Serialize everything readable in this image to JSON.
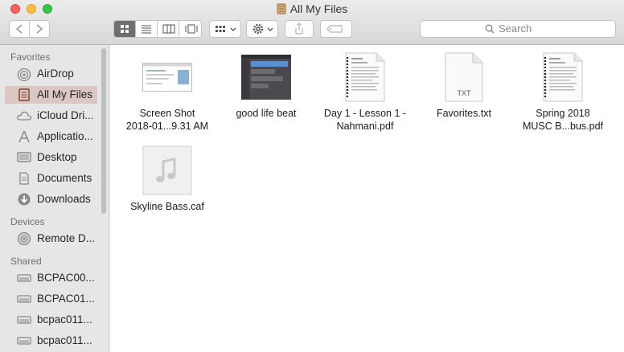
{
  "window": {
    "title": "All My Files"
  },
  "toolbar": {
    "search_placeholder": "Search"
  },
  "sidebar": {
    "sections": [
      {
        "header": "Favorites",
        "items": [
          {
            "label": "AirDrop",
            "icon": "airdrop-icon"
          },
          {
            "label": "All My Files",
            "icon": "all-my-files-icon",
            "selected": true
          },
          {
            "label": "iCloud Dri...",
            "icon": "cloud-icon"
          },
          {
            "label": "Applicatio...",
            "icon": "applications-icon"
          },
          {
            "label": "Desktop",
            "icon": "desktop-icon"
          },
          {
            "label": "Documents",
            "icon": "documents-icon"
          },
          {
            "label": "Downloads",
            "icon": "downloads-icon"
          }
        ]
      },
      {
        "header": "Devices",
        "items": [
          {
            "label": "Remote D...",
            "icon": "disc-icon"
          }
        ]
      },
      {
        "header": "Shared",
        "items": [
          {
            "label": "BCPAC00...",
            "icon": "server-icon"
          },
          {
            "label": "BCPAC01...",
            "icon": "server-icon"
          },
          {
            "label": "bcpac011...",
            "icon": "server-icon"
          },
          {
            "label": "bcpac011...",
            "icon": "server-icon"
          }
        ]
      }
    ]
  },
  "files": [
    {
      "line1": "Screen Shot",
      "line2": "2018-01...9.31 AM",
      "icon": "screenshot-thumbnail"
    },
    {
      "line1": "good life beat",
      "line2": "",
      "icon": "garageband-project-thumbnail"
    },
    {
      "line1": "Day 1 - Lesson 1 -",
      "line2": "Nahmani.pdf",
      "icon": "pdf-document-icon"
    },
    {
      "line1": "Favorites.txt",
      "line2": "",
      "icon": "txt-document-icon",
      "badge": "TXT"
    },
    {
      "line1": "Spring 2018",
      "line2": "MUSC B...bus.pdf",
      "icon": "pdf-document-icon"
    },
    {
      "line1": "Skyline Bass.caf",
      "line2": "",
      "icon": "audio-file-icon"
    }
  ],
  "colors": {
    "sidebar_selected": "#dcc6c2",
    "close": "#fc605c",
    "minimize": "#fdbc40",
    "zoom": "#34c84a"
  }
}
